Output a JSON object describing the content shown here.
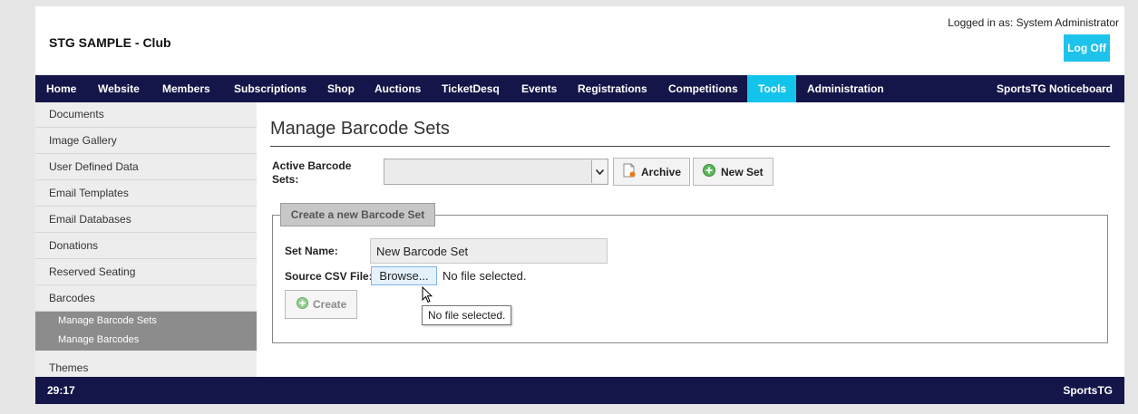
{
  "header": {
    "club_name": "STG SAMPLE - Club",
    "logged_in": "Logged in as: System Administrator",
    "logoff_label": "Log Off"
  },
  "nav": {
    "items": [
      {
        "label": "Home",
        "active": false
      },
      {
        "label": "Website",
        "active": false
      },
      {
        "label": "Members",
        "active": false
      },
      {
        "label": "Subscriptions",
        "active": false
      },
      {
        "label": "Shop",
        "active": false
      },
      {
        "label": "Auctions",
        "active": false
      },
      {
        "label": "TicketDesq",
        "active": false
      },
      {
        "label": "Events",
        "active": false
      },
      {
        "label": "Registrations",
        "active": false
      },
      {
        "label": "Competitions",
        "active": false
      },
      {
        "label": "Tools",
        "active": true
      },
      {
        "label": "Administration",
        "active": false
      }
    ],
    "right_link": "SportsTG Noticeboard"
  },
  "sidebar": {
    "items": [
      {
        "label": "Documents"
      },
      {
        "label": "Image Gallery"
      },
      {
        "label": "User Defined Data"
      },
      {
        "label": "Email Templates"
      },
      {
        "label": "Email Databases"
      },
      {
        "label": "Donations"
      },
      {
        "label": "Reserved Seating"
      },
      {
        "label": "Barcodes"
      }
    ],
    "sub_items": [
      {
        "label": "Manage Barcode Sets"
      },
      {
        "label": "Manage Barcodes"
      }
    ],
    "after_items": [
      {
        "label": "Themes"
      }
    ]
  },
  "main": {
    "title": "Manage Barcode Sets",
    "active_sets_label": "Active Barcode Sets:",
    "active_sets_value": "",
    "archive_label": "Archive",
    "new_set_label": "New Set",
    "create_section": {
      "legend": "Create a new Barcode Set",
      "set_name_label": "Set Name:",
      "set_name_value": "New Barcode Set",
      "source_csv_label": "Source CSV File:",
      "browse_label": "Browse...",
      "no_file_text": "No file selected.",
      "create_label": "Create",
      "tooltip": "No file selected."
    }
  },
  "footer": {
    "timer": "29:17",
    "brand": "SportsTG"
  },
  "colors": {
    "nav_bg": "#141548",
    "accent": "#12c4ec",
    "sidebar_bg": "#ededed",
    "sidebar_active_bg": "#8c8c8c",
    "icon_green": "#5cb85c"
  },
  "icons": {
    "archive": "document-archive-icon",
    "new_set": "plus-circle-icon",
    "create": "plus-circle-icon",
    "select": "chevron-down-icon",
    "cursor": "mouse-cursor-icon"
  }
}
